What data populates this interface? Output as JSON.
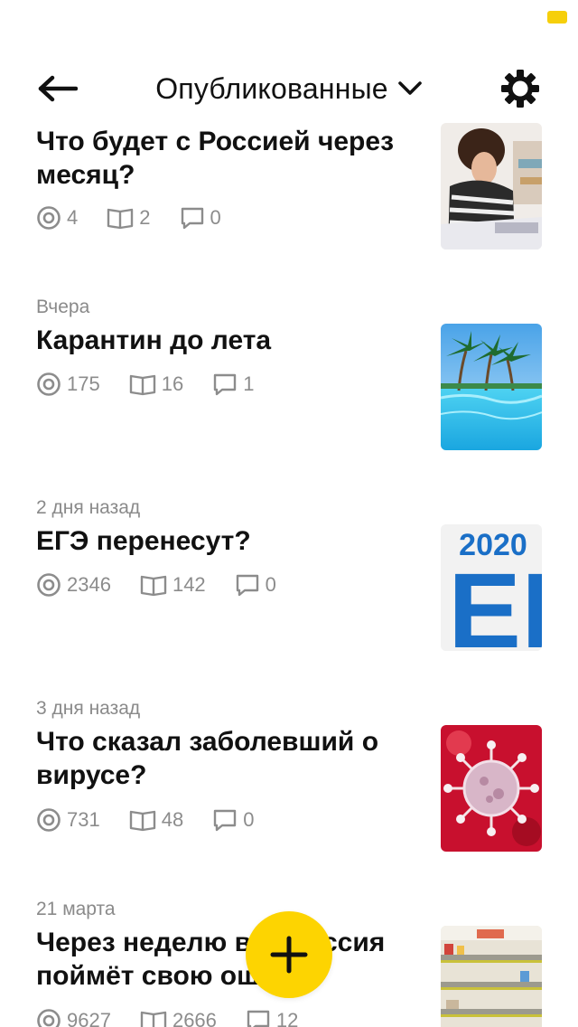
{
  "header": {
    "title": "Опубликованные"
  },
  "articles": [
    {
      "date": "",
      "title": "Что будет с Россией через месяц?",
      "views": "4",
      "reads": "2",
      "comments": "0",
      "thumb": "woman-stressed-thumbnail"
    },
    {
      "date": "Вчера",
      "title": "Карантин до лета",
      "views": "175",
      "reads": "16",
      "comments": "1",
      "thumb": "palm-pool-thumbnail"
    },
    {
      "date": "2 дня назад",
      "title": "ЕГЭ перенесут?",
      "views": "2346",
      "reads": "142",
      "comments": "0",
      "thumb": "ege-2020-thumbnail",
      "thumb_text_year": "2020",
      "thumb_text_main": "ЕГ"
    },
    {
      "date": "3 дня назад",
      "title": "Что сказал заболевший о вирусе?",
      "views": "731",
      "reads": "48",
      "comments": "0",
      "thumb": "virus-thumbnail"
    },
    {
      "date": "21 марта",
      "title": "Через неделю вся Россия поймёт свою ошибку",
      "views": "9627",
      "reads": "2666",
      "comments": "12",
      "thumb": "empty-shelves-thumbnail"
    }
  ],
  "colors": {
    "accent": "#fdd401",
    "meta_gray": "#8c8c8c",
    "ege_blue": "#1a6fc7"
  },
  "icons": {
    "back": "arrow-left-icon",
    "dropdown": "chevron-down-icon",
    "settings": "gear-icon",
    "views": "eye-icon",
    "reads": "book-icon",
    "comments": "comment-icon",
    "add": "plus-icon"
  }
}
